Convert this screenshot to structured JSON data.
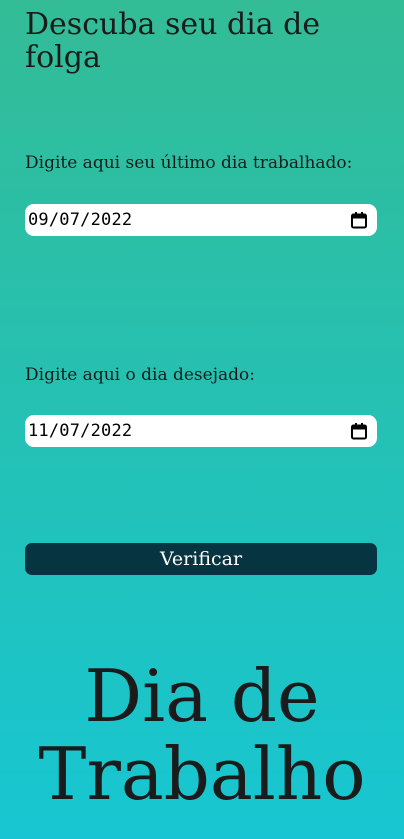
{
  "header": {
    "title": "Descuba seu dia de folga"
  },
  "form": {
    "last_day_label": "Digite aqui seu último dia trabalhado:",
    "last_day_value": "09/07/2022",
    "desired_day_label": "Digite aqui o dia desejado:",
    "desired_day_value": "11/07/2022",
    "submit_label": "Verificar"
  },
  "result": {
    "text": "Dia de Trabalho"
  },
  "icons": {
    "date_picker": "calendar-icon"
  },
  "colors": {
    "gradient_top": "#33bc96",
    "gradient_bottom": "#17c6d2",
    "button_bg": "#063440",
    "text": "#1b1b1b"
  }
}
